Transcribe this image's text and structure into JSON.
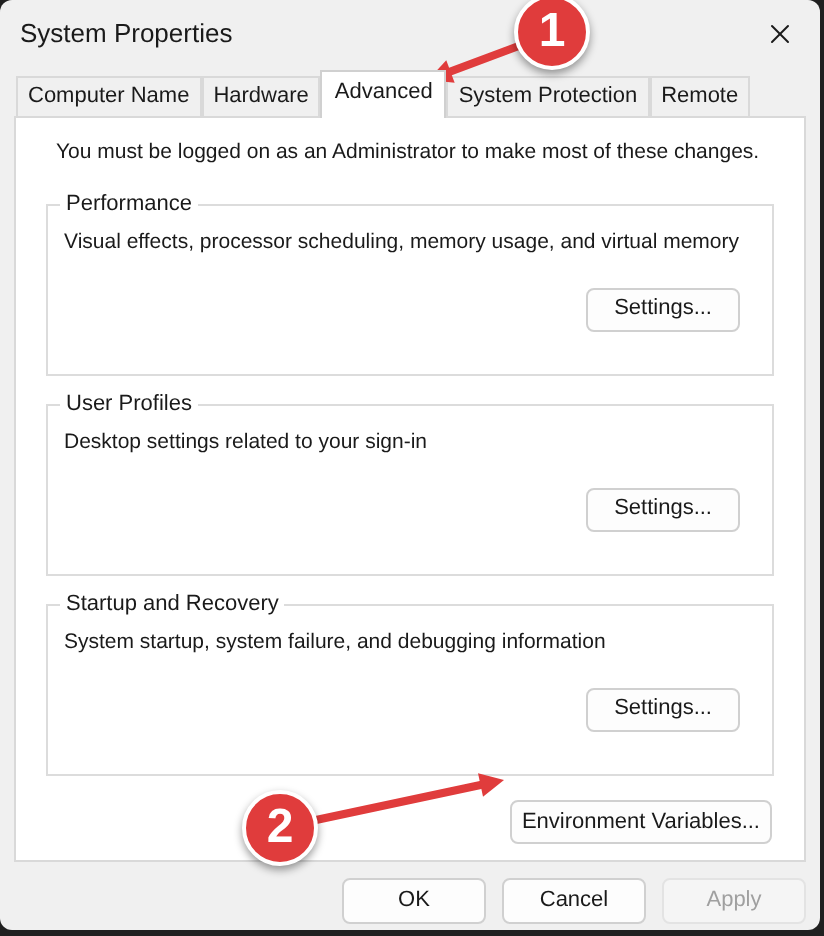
{
  "window": {
    "title": "System Properties"
  },
  "tabs": [
    {
      "label": "Computer Name",
      "selected": false
    },
    {
      "label": "Hardware",
      "selected": false
    },
    {
      "label": "Advanced",
      "selected": true
    },
    {
      "label": "System Protection",
      "selected": false
    },
    {
      "label": "Remote",
      "selected": false
    }
  ],
  "notice": "You must be logged on as an Administrator to make most of these changes.",
  "groups": [
    {
      "title": "Performance",
      "description": "Visual effects, processor scheduling, memory usage, and virtual memory",
      "button": "Settings..."
    },
    {
      "title": "User Profiles",
      "description": "Desktop settings related to your sign-in",
      "button": "Settings..."
    },
    {
      "title": "Startup and Recovery",
      "description": "System startup, system failure, and debugging information",
      "button": "Settings..."
    }
  ],
  "environment_button": "Environment Variables...",
  "buttons": [
    {
      "label": "OK",
      "disabled": false
    },
    {
      "label": "Cancel",
      "disabled": false
    },
    {
      "label": "Apply",
      "disabled": true
    }
  ],
  "annotations": [
    {
      "label": "1"
    },
    {
      "label": "2"
    }
  ]
}
